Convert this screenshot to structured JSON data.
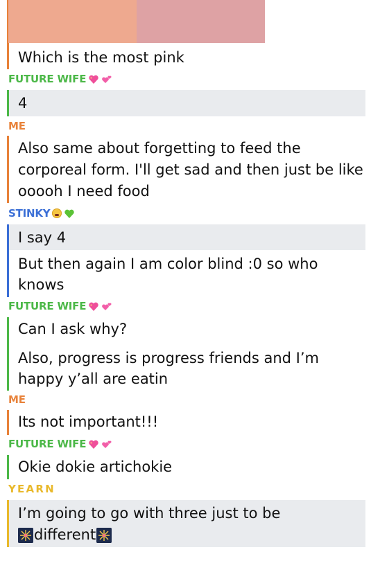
{
  "colors": {
    "me": "#e8823a",
    "future_wife": "#4cb848",
    "stinky": "#3b6fd6",
    "yearn": "#e9b92c",
    "swatch_left": "#eea98f",
    "swatch_right": "#dea2a4",
    "highlight": "#e9ebee"
  },
  "messages": [
    {
      "text": "Which is the most pink"
    },
    {
      "sender": "FUTURE WIFE",
      "emoji": [
        "sparkling-heart",
        "two-hearts"
      ]
    },
    {
      "text": "4"
    },
    {
      "sender": "ME"
    },
    {
      "lines": [
        "Also same about forgetting to feed the",
        "corporeal form. I'll get sad and then just be like",
        "ooooh I need food"
      ]
    },
    {
      "sender": "STINKY",
      "emoji": [
        "tired-face",
        "green-heart"
      ]
    },
    {
      "text": "I say 4"
    },
    {
      "lines": [
        "But then again I am color blind :0 so who",
        "knows"
      ]
    },
    {
      "sender": "FUTURE WIFE",
      "emoji": [
        "sparkling-heart",
        "two-hearts"
      ]
    },
    {
      "text": "Can I ask why?"
    },
    {
      "lines": [
        "Also, progress is progress friends and I’m",
        "happy y’all are eatin"
      ]
    },
    {
      "sender": "ME"
    },
    {
      "text": "Its not important!!!"
    },
    {
      "sender": "FUTURE WIFE",
      "emoji": [
        "sparkling-heart",
        "two-hearts"
      ]
    },
    {
      "text": "Okie dokie artichokie"
    },
    {
      "sender": "YEARN"
    },
    {
      "lines": [
        "I’m going to go with three just to be",
        "different"
      ],
      "emoji": [
        "fireworks-icon",
        "fireworks-icon"
      ]
    }
  ]
}
